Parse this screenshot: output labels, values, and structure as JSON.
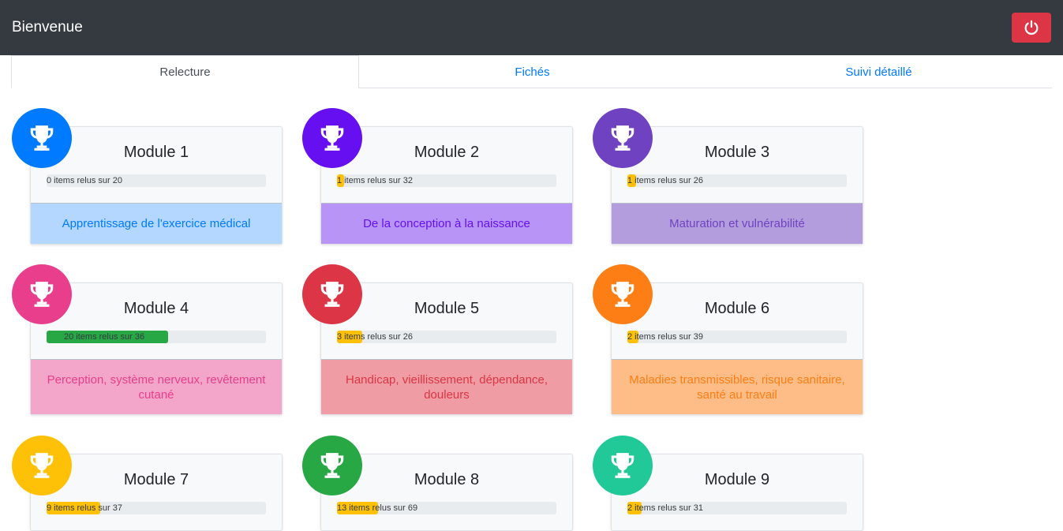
{
  "navbar": {
    "brand": "Bienvenue",
    "logout_icon": "power-icon",
    "logout_color": "#dc3545"
  },
  "tabs": [
    {
      "label": "Relecture",
      "active": true
    },
    {
      "label": "Fichés",
      "active": false
    },
    {
      "label": "Suivi détaillé",
      "active": false
    }
  ],
  "modules": [
    {
      "title": "Module 1",
      "progress_text": "0 items relus sur 20",
      "done": 0,
      "total": 20,
      "subtitle": "Apprentissage de l'exercice médical",
      "color": "#007bff",
      "foot_bg": "#b3d7ff",
      "bar_color": "#ffc107",
      "icon": "trophy-icon"
    },
    {
      "title": "Module 2",
      "progress_text": "1 items relus sur 32",
      "done": 1,
      "total": 32,
      "subtitle": "De la conception à la naissance",
      "color": "#6610f2",
      "foot_bg": "#b794f6",
      "bar_color": "#ffc107",
      "icon": "trophy-icon"
    },
    {
      "title": "Module 3",
      "progress_text": "1 items relus sur 26",
      "done": 1,
      "total": 26,
      "subtitle": "Maturation et vulnérabilité",
      "color": "#6f42c1",
      "foot_bg": "#b49ddc",
      "bar_color": "#ffc107",
      "icon": "trophy-icon"
    },
    {
      "title": "Module 4",
      "progress_text": "20 items relus sur 36",
      "done": 20,
      "total": 36,
      "subtitle": "Perception, système nerveux, revêtement cutané",
      "color": "#e83e8c",
      "foot_bg": "#f3a6c9",
      "bar_color": "#28a745",
      "icon": "trophy-icon"
    },
    {
      "title": "Module 5",
      "progress_text": "3 items relus sur 26",
      "done": 3,
      "total": 26,
      "subtitle": "Handicap, vieillissement, dépendance, douleurs",
      "color": "#dc3545",
      "foot_bg": "#ef9ca4",
      "bar_color": "#ffc107",
      "icon": "trophy-icon"
    },
    {
      "title": "Module 6",
      "progress_text": "2 items relus sur 39",
      "done": 2,
      "total": 39,
      "subtitle": "Maladies transmissibles, risque sanitaire, santé au travail",
      "color": "#fd7e14",
      "foot_bg": "#febd87",
      "bar_color": "#ffc107",
      "icon": "trophy-icon"
    },
    {
      "title": "Module 7",
      "progress_text": "9 items relus sur 37",
      "done": 9,
      "total": 37,
      "subtitle": "",
      "color": "#ffc107",
      "foot_bg": "#ffe083",
      "bar_color": "#ffc107",
      "icon": "trophy-icon"
    },
    {
      "title": "Module 8",
      "progress_text": "13 items relus sur 69",
      "done": 13,
      "total": 69,
      "subtitle": "",
      "color": "#28a745",
      "foot_bg": "#94d3a2",
      "bar_color": "#ffc107",
      "icon": "trophy-icon"
    },
    {
      "title": "Module 9",
      "progress_text": "2 items relus sur 31",
      "done": 2,
      "total": 31,
      "subtitle": "",
      "color": "#20c997",
      "foot_bg": "#8fe4cb",
      "bar_color": "#ffc107",
      "icon": "trophy-icon"
    }
  ]
}
